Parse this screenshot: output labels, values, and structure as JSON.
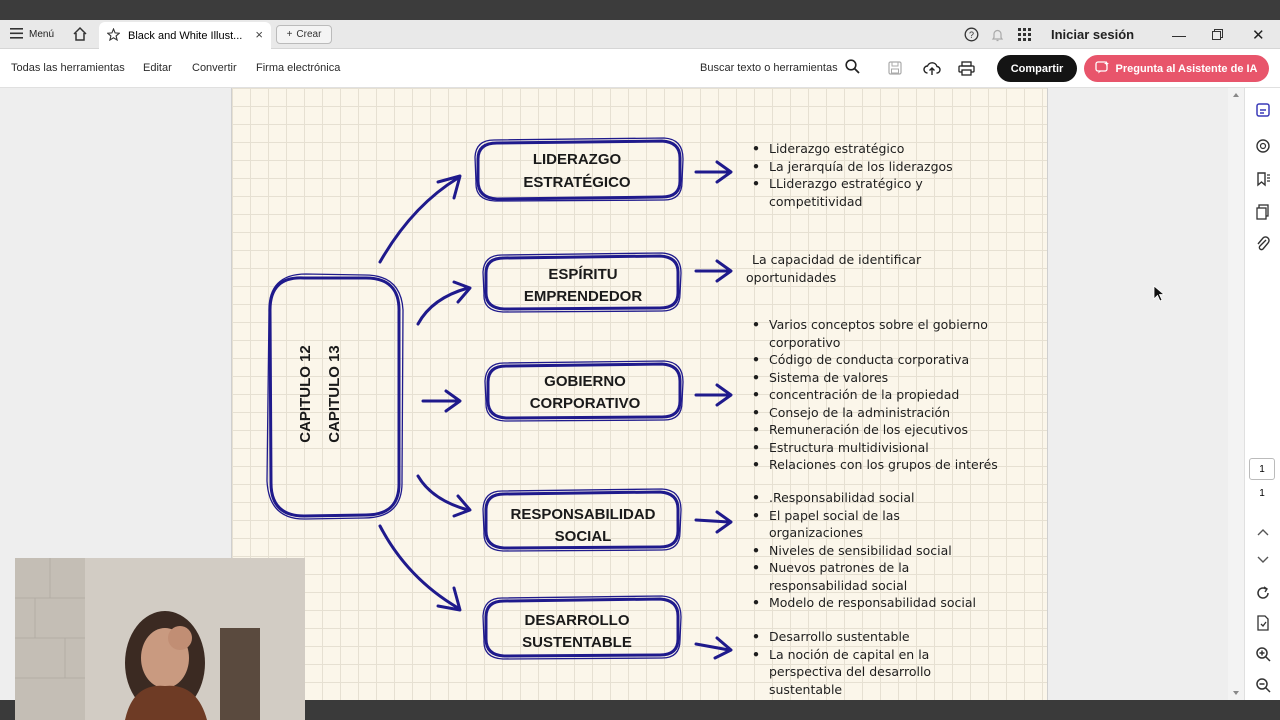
{
  "tabbar": {
    "menu_label": "Menú",
    "tab_title": "Black and White Illust...",
    "create_label": "Crear",
    "signin_label": "Iniciar sesión"
  },
  "toolbar": {
    "all_tools": "Todas las herramientas",
    "edit": "Editar",
    "convert": "Convertir",
    "esign": "Firma electrónica",
    "search": "Buscar texto o herramientas",
    "share": "Compartir",
    "ai_assistant": "Pregunta al Asistente de IA"
  },
  "colors": {
    "ink": "#1f1a8c",
    "share_bg": "#141414",
    "ai_bg": "#e8556b"
  },
  "diagram": {
    "center": [
      "CAPITULO 12",
      "CAPITULO 13"
    ],
    "nodes": [
      {
        "line1": "LIDERAZGO",
        "line2": "ESTRATÉGICO"
      },
      {
        "line1": "ESPÍRITU",
        "line2": "EMPRENDEDOR"
      },
      {
        "line1": "GOBIERNO",
        "line2": "CORPORATIVO"
      },
      {
        "line1": "RESPONSABILIDAD",
        "line2": "SOCIAL"
      },
      {
        "line1": "DESARROLLO",
        "line2": "SUSTENTABLE"
      }
    ],
    "liderazgo": [
      "Liderazgo estratégico",
      "La jerarquía de los liderazgos",
      "LLiderazgo estratégico y competitividad"
    ],
    "espiritu_note": "La capacidad de identificar oportunidades",
    "gobierno": [
      "Varios conceptos sobre el gobierno corporativo",
      "Código de conducta corporativa",
      "Sistema de valores",
      "concentración de la propiedad",
      "Consejo de la administración",
      "Remuneración de los ejecutivos",
      "Estructura multidivisional",
      "Relaciones con los grupos de interés"
    ],
    "responsabilidad": [
      ".Responsabilidad social",
      "El papel social de las organizaciones",
      "Niveles de sensibilidad social",
      "Nuevos patrones de la responsabilidad social",
      "Modelo de responsabilidad social"
    ],
    "desarrollo": [
      "Desarrollo sustentable",
      "La noción de capital en la perspectiva del desarrollo sustentable"
    ]
  },
  "pager": {
    "current": "1",
    "total": "1"
  }
}
